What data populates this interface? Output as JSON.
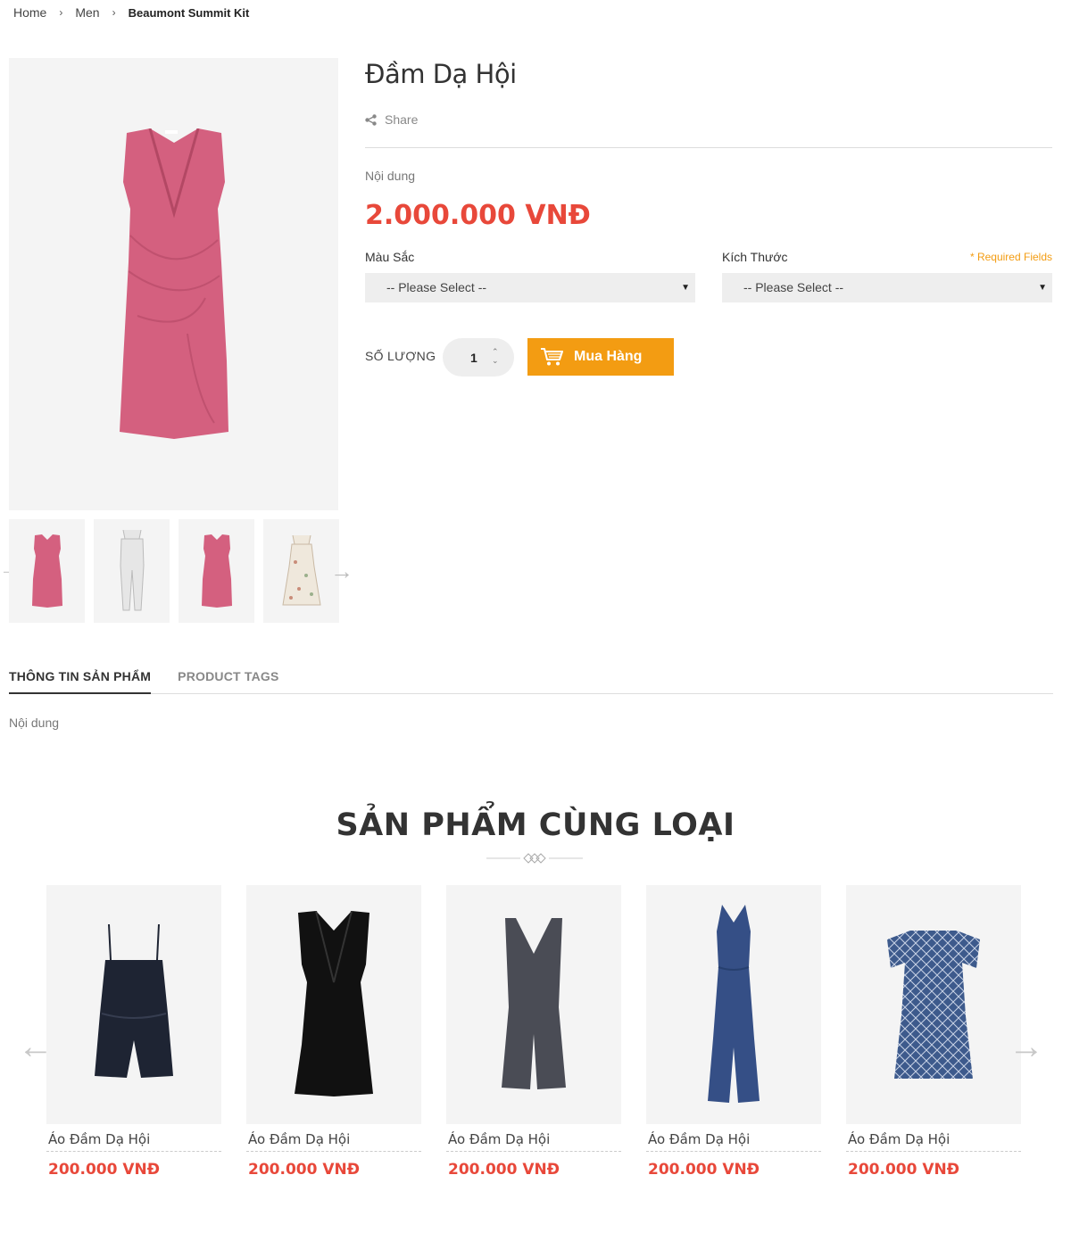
{
  "breadcrumb": {
    "home": "Home",
    "category": "Men",
    "current": "Beaumont Summit Kit",
    "separator": "›"
  },
  "product": {
    "title": "Đầm Dạ Hội",
    "share_label": "Share",
    "description": "Nội dung",
    "price": "2.000.000 VNĐ",
    "color_label": "Màu Sắc",
    "size_label": "Kích Thước",
    "required_note": "* Required Fields",
    "color_select": "-- Please Select --",
    "size_select": "-- Please Select --",
    "qty_label": "SỐ LƯỢNG",
    "qty_value": "1",
    "buy_label": "Mua Hàng",
    "thumbnail_icons": [
      "pink-dress",
      "white-jumpsuit",
      "pink-dress",
      "floral-dress"
    ]
  },
  "tabs": [
    {
      "label": "THÔNG TIN SẢN PHẨM",
      "active": true
    },
    {
      "label": "PRODUCT TAGS",
      "active": false
    }
  ],
  "tab_content": "Nội dung",
  "related": {
    "title": "SẢN PHẨM CÙNG LOẠI",
    "items": [
      {
        "name": "Áo Đầm Dạ Hội",
        "price": "200.000 VNĐ",
        "icon": "navy-romper"
      },
      {
        "name": "Áo Đầm Dạ Hội",
        "price": "200.000 VNĐ",
        "icon": "black-wrap-dress"
      },
      {
        "name": "Áo Đầm Dạ Hội",
        "price": "200.000 VNĐ",
        "icon": "grey-jumpsuit"
      },
      {
        "name": "Áo Đầm Dạ Hội",
        "price": "200.000 VNĐ",
        "icon": "blue-halter-jumpsuit"
      },
      {
        "name": "Áo Đầm Dạ Hội",
        "price": "200.000 VNĐ",
        "icon": "blue-print-dress"
      }
    ]
  },
  "colors": {
    "accent": "#f39c12",
    "price": "#e8483a",
    "pink_dress": "#d4607f"
  }
}
